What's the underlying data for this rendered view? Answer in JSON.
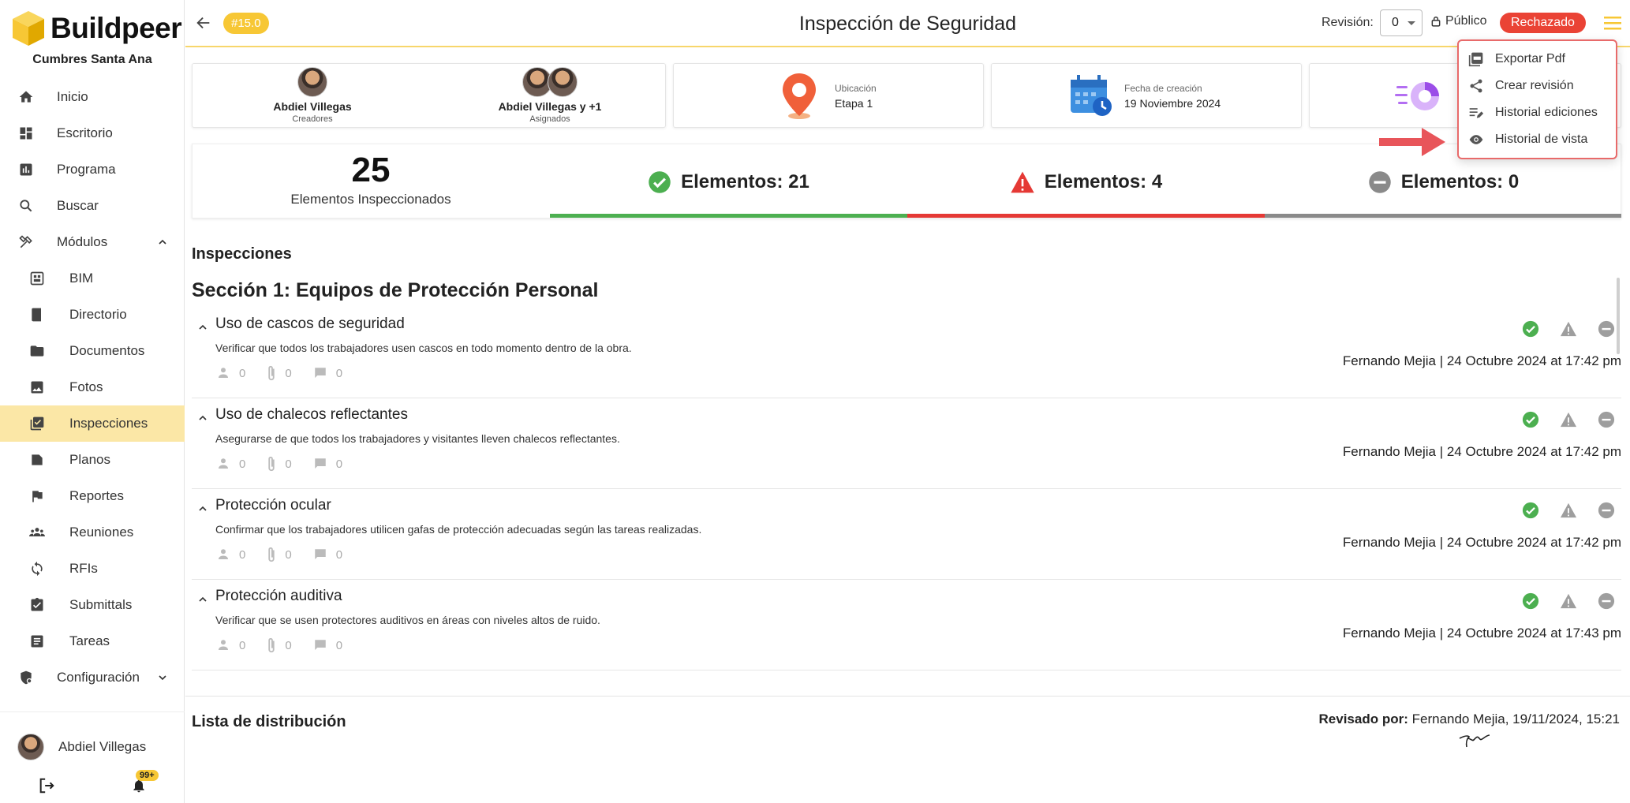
{
  "sidebar": {
    "logo_text": "Buildpeer",
    "company": "Cumbres Santa Ana",
    "items": [
      {
        "label": "Inicio"
      },
      {
        "label": "Escritorio"
      },
      {
        "label": "Programa"
      },
      {
        "label": "Buscar"
      },
      {
        "label": "Módulos"
      },
      {
        "label": "BIM"
      },
      {
        "label": "Directorio"
      },
      {
        "label": "Documentos"
      },
      {
        "label": "Fotos"
      },
      {
        "label": "Inspecciones"
      },
      {
        "label": "Planos"
      },
      {
        "label": "Reportes"
      },
      {
        "label": "Reuniones"
      },
      {
        "label": "RFIs"
      },
      {
        "label": "Submittals"
      },
      {
        "label": "Tareas"
      },
      {
        "label": "Configuración"
      }
    ],
    "user_name": "Abdiel Villegas",
    "notifications": "99+"
  },
  "header": {
    "version": "#15.0",
    "title": "Inspección de Seguridad",
    "revision_label": "Revisión:",
    "revision_value": "0",
    "visibility": "Público",
    "status": "Rechazado"
  },
  "colors": {
    "accent": "#f7c735",
    "ok": "#4caf50",
    "warn": "#e53935",
    "na": "#8a8a8a"
  },
  "info": {
    "creator_name": "Abdiel Villegas",
    "creator_role": "Creadores",
    "assigned_name": "Abdiel Villegas y +1",
    "assigned_role": "Asignados",
    "location_label": "Ubicación",
    "location_value": "Etapa 1",
    "date_label": "Fecha de creación",
    "date_value": "19 Noviembre 2024"
  },
  "stats": {
    "total": "25",
    "total_label": "Elementos Inspeccionados",
    "ok": "Elementos: 21",
    "warn": "Elementos: 4",
    "na": "Elementos: 0"
  },
  "inspections": {
    "heading": "Inspecciones",
    "section_title": "Sección 1: Equipos de Protección Personal",
    "items": [
      {
        "title": "Uso de cascos de seguridad",
        "desc": "Verificar que todos los trabajadores usen cascos en todo momento dentro de la obra.",
        "assignees": "0",
        "attachments": "0",
        "comments": "0",
        "author": "Fernando Mejia | 24 Octubre 2024 at 17:42 pm"
      },
      {
        "title": "Uso de chalecos reflectantes",
        "desc": "Asegurarse de que todos los trabajadores y visitantes lleven chalecos reflectantes.",
        "assignees": "0",
        "attachments": "0",
        "comments": "0",
        "author": "Fernando Mejia | 24 Octubre 2024 at 17:42 pm"
      },
      {
        "title": "Protección ocular",
        "desc": "Confirmar que los trabajadores utilicen gafas de protección adecuadas según las tareas realizadas.",
        "assignees": "0",
        "attachments": "0",
        "comments": "0",
        "author": "Fernando Mejia | 24 Octubre 2024 at 17:42 pm"
      },
      {
        "title": "Protección auditiva",
        "desc": "Verificar que se usen protectores auditivos en áreas con niveles altos de ruido.",
        "assignees": "0",
        "attachments": "0",
        "comments": "0",
        "author": "Fernando Mejia | 24 Octubre 2024 at 17:43 pm"
      }
    ]
  },
  "distribution": {
    "heading": "Lista de distribución",
    "reviewed_label": "Revisado por:",
    "reviewed_value": "Fernando Mejia, 19/11/2024, 15:21"
  },
  "menu": {
    "items": [
      {
        "label": "Exportar Pdf"
      },
      {
        "label": "Crear revisión"
      },
      {
        "label": "Historial ediciones"
      },
      {
        "label": "Historial de vista"
      }
    ]
  }
}
